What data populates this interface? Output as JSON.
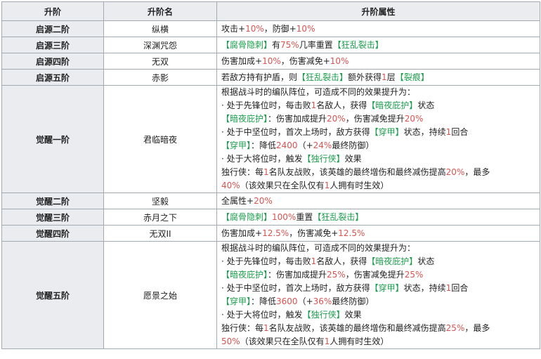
{
  "table": {
    "headers": [
      "升阶",
      "升阶名",
      "升阶属性"
    ],
    "rows": [
      {
        "stage": "启源二阶",
        "name": "纵横",
        "lines": [
          [
            [
              "攻击+",
              ""
            ],
            [
              "10%",
              "n"
            ],
            [
              "，防御+",
              ""
            ],
            [
              "10%",
              "n"
            ]
          ]
        ]
      },
      {
        "stage": "启源三阶",
        "name": "深渊咒怨",
        "lines": [
          [
            [
              "【腐骨隐刺】",
              "k"
            ],
            [
              "有",
              ""
            ],
            [
              "75%",
              "n"
            ],
            [
              "几率重置",
              ""
            ],
            [
              "【狂乱裂击】",
              "k"
            ]
          ]
        ]
      },
      {
        "stage": "启源四阶",
        "name": "无双",
        "lines": [
          [
            [
              "伤害加成+",
              ""
            ],
            [
              "10%",
              "n"
            ],
            [
              "，伤害减免+",
              ""
            ],
            [
              "10%",
              "n"
            ]
          ]
        ]
      },
      {
        "stage": "启源五阶",
        "name": "赤影",
        "lines": [
          [
            [
              "若敌方持有护盾，则",
              ""
            ],
            [
              "【狂乱裂击】",
              "k"
            ],
            [
              "额外获得",
              ""
            ],
            [
              "1",
              "n"
            ],
            [
              "层",
              ""
            ],
            [
              "【裂痕】",
              "k"
            ]
          ]
        ]
      },
      {
        "stage": "觉醒一阶",
        "name": "君临暗夜",
        "lines": [
          [
            [
              "根据战斗时的编队阵位，可造成不同的效果提升为：",
              ""
            ]
          ],
          [
            [
              "· 处于先锋位时，每击败",
              ""
            ],
            [
              "1",
              "n"
            ],
            [
              "名敌人，获得",
              ""
            ],
            [
              "【暗夜庇护】",
              "k"
            ],
            [
              "状态",
              ""
            ]
          ],
          [
            [
              "【暗夜庇护】",
              "k"
            ],
            [
              "：伤害加成提升",
              ""
            ],
            [
              "20%",
              "n"
            ],
            [
              "，伤害减免提升",
              ""
            ],
            [
              "20%",
              "n"
            ]
          ],
          [
            [
              "· 处于中坚位时，首次上场时，敌方获得",
              ""
            ],
            [
              "【穿甲】",
              "k"
            ],
            [
              "状态，持续",
              ""
            ],
            [
              "1",
              "n"
            ],
            [
              "回合",
              ""
            ]
          ],
          [
            [
              "【穿甲】",
              "k"
            ],
            [
              "：降低",
              ""
            ],
            [
              "2400",
              "n"
            ],
            [
              "（+",
              ""
            ],
            [
              "24%",
              "n"
            ],
            [
              "最终防御）",
              ""
            ]
          ],
          [
            [
              "· 处于大将位时，触发",
              ""
            ],
            [
              "【独行侠】",
              "k"
            ],
            [
              "效果",
              ""
            ]
          ],
          [
            [
              "独行侠：每",
              ""
            ],
            [
              "1",
              "n"
            ],
            [
              "名队友战败，该英雄的最终增伤和最终减伤提高",
              ""
            ],
            [
              "20%",
              "n"
            ],
            [
              "，最多",
              ""
            ]
          ],
          [
            [
              "40%",
              "n"
            ],
            [
              "（该效果只在全队仅有",
              ""
            ],
            [
              "1",
              "n"
            ],
            [
              "人拥有时生效）",
              ""
            ]
          ]
        ]
      },
      {
        "stage": "觉醒二阶",
        "name": "坚毅",
        "lines": [
          [
            [
              "全属性+",
              ""
            ],
            [
              "20%",
              "n"
            ]
          ]
        ]
      },
      {
        "stage": "觉醒三阶",
        "name": "赤月之下",
        "lines": [
          [
            [
              "【腐骨隐刺】",
              "k"
            ],
            [
              "100%",
              "n"
            ],
            [
              "重置",
              ""
            ],
            [
              "【狂乱裂击】",
              "k"
            ]
          ]
        ]
      },
      {
        "stage": "觉醒四阶",
        "name": "无双II",
        "lines": [
          [
            [
              "伤害加成+",
              ""
            ],
            [
              "12.5%",
              "n"
            ],
            [
              "，伤害减免+",
              ""
            ],
            [
              "12.5%",
              "n"
            ]
          ]
        ]
      },
      {
        "stage": "觉醒五阶",
        "name": "愿景之始",
        "lines": [
          [
            [
              "根据战斗时的编队阵位，可造成不同的效果提升为：",
              ""
            ]
          ],
          [
            [
              "· 处于先锋位时，每击败",
              ""
            ],
            [
              "1",
              "n"
            ],
            [
              "名敌人，获得",
              ""
            ],
            [
              "【暗夜庇护】",
              "k"
            ],
            [
              "状态",
              ""
            ]
          ],
          [
            [
              "【暗夜庇护】",
              "k"
            ],
            [
              "：伤害加成提升",
              ""
            ],
            [
              "25%",
              "n"
            ],
            [
              "，伤害减免提升",
              ""
            ],
            [
              "25%",
              "n"
            ]
          ],
          [
            [
              "· 处于中坚位时，首次上场时，敌方获得",
              ""
            ],
            [
              "【穿甲】",
              "k"
            ],
            [
              "状态，持续",
              ""
            ],
            [
              "1",
              "n"
            ],
            [
              "回合",
              ""
            ]
          ],
          [
            [
              "【穿甲】",
              "k"
            ],
            [
              "：降低",
              ""
            ],
            [
              "3600",
              "n"
            ],
            [
              "（+",
              ""
            ],
            [
              "36%",
              "n"
            ],
            [
              "最终防御）",
              ""
            ]
          ],
          [
            [
              "· 处于大将位时，触发",
              ""
            ],
            [
              "【独行侠】",
              "k"
            ],
            [
              "效果",
              ""
            ]
          ],
          [
            [
              "独行侠：每",
              ""
            ],
            [
              "1",
              "n"
            ],
            [
              "名队友战败，该英雄的最终增伤和最终减伤提高",
              ""
            ],
            [
              "25%",
              "n"
            ],
            [
              "，最多",
              ""
            ]
          ],
          [
            [
              "50%",
              "n"
            ],
            [
              "（该效果只在全队仅有",
              ""
            ],
            [
              "1",
              "n"
            ],
            [
              "人拥有时生效）",
              ""
            ]
          ]
        ]
      }
    ]
  },
  "colors": {
    "number": "#d9534f",
    "keyword": "#1a9e4b",
    "header_bg": "#eaecf0",
    "border": "#a2a9b1"
  }
}
